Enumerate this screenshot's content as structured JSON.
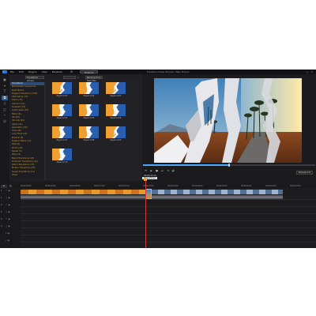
{
  "app": {
    "menu": [
      "File",
      "Edit",
      "Plugins",
      "View",
      "Playback"
    ],
    "gear_icon": "gear-icon",
    "produce_label": "Produce",
    "project_title": "Transition Video Tutorial - Main Project"
  },
  "toolbar": {
    "tools": [
      {
        "name": "media-icon",
        "glyph": "▣"
      },
      {
        "name": "effects-icon",
        "glyph": "✦"
      },
      {
        "name": "title-icon",
        "glyph": "T"
      },
      {
        "name": "transition-icon",
        "glyph": "⧉"
      },
      {
        "name": "audio-icon",
        "glyph": "♫"
      },
      {
        "name": "pip-icon",
        "glyph": "◫"
      },
      {
        "name": "particle-icon",
        "glyph": "✧"
      },
      {
        "name": "sticker-icon",
        "glyph": "☺"
      }
    ],
    "active_index": 3
  },
  "library": {
    "dropdown": "Transitions Library",
    "filter": "Remove from Favorites",
    "categories": [
      "Transitions",
      "Blockbuster Sequences",
      "Dual Motion",
      "Elegant Transitions (125)",
      "Alternative (72)",
      "Glitch (15)",
      "Cartoon (11)",
      "Gradient (53)",
      "Light Leaks (22)",
      "Block (6)",
      "3D (84)",
      "3D-Like (40)",
      "Alpha (41)",
      "Geometric (39)",
      "Grid (18)",
      "Lens Flare (20)",
      "Medical (8)",
      "Organic Blend (11)",
      "Peel (9)",
      "Photo (13)",
      "Speed (5)",
      "Wipe (4)",
      "Blend Transitions (23)",
      "Dramatic Transitions (32)",
      "Glitch Transitions (15)",
      "Motion Transitions (35)",
      "Shape Transitions (11)",
      "Other"
    ],
    "selected_category_index": 0,
    "thumbs": [
      {
        "label": "Papercut 01",
        "col": 0,
        "row": 0,
        "variant": "a"
      },
      {
        "label": "Papercut 02",
        "col": 1,
        "row": 0,
        "variant": "b"
      },
      {
        "label": "Papercut 03",
        "col": 2,
        "row": 0,
        "variant": "a"
      },
      {
        "label": "Papercut 04",
        "col": 0,
        "row": 1,
        "variant": "b"
      },
      {
        "label": "Papercut 05",
        "col": 1,
        "row": 1,
        "variant": "b"
      },
      {
        "label": "Papercut 06",
        "col": 2,
        "row": 1,
        "variant": "b"
      },
      {
        "label": "Papercut 07",
        "col": 0,
        "row": 2,
        "variant": "b"
      },
      {
        "label": "Papercut 08",
        "col": 1,
        "row": 2,
        "variant": "b"
      },
      {
        "label": "Papercut 09",
        "col": 2,
        "row": 2,
        "variant": "a"
      },
      {
        "label": "Papercut 10",
        "col": 0,
        "row": 3,
        "variant": "b"
      }
    ]
  },
  "preview": {
    "progress_fraction": 0.5,
    "controls": [
      "⏮",
      "▶",
      "■",
      "⏭",
      "⟲",
      "🔊"
    ],
    "timecode": "00:00:30:16",
    "resolution": "Preview 1/2",
    "tooltip": "Stop (Ctrl+/)"
  },
  "timeline": {
    "btn_a": "⊞",
    "btn_b": "▤",
    "ticks": [
      "00:00:00:00",
      "00:00:04:00",
      "00:00:08:00",
      "00:00:12:00",
      "00:00:16:00",
      "00:00:20:00",
      "00:00:24:00",
      "00:00:28:00",
      "00:00:32:00",
      "00:00:36:00",
      "00:00:40:00",
      "00:00:44:00"
    ],
    "tracks": [
      {
        "num": "1",
        "icon": "▭"
      },
      {
        "num": "1",
        "icon": "♫"
      },
      {
        "num": "2",
        "icon": "▭"
      },
      {
        "num": "2",
        "icon": "♫"
      },
      {
        "num": "3",
        "icon": "▭"
      },
      {
        "num": "3",
        "icon": "♫"
      },
      {
        "num": "",
        "icon": "T"
      },
      {
        "num": "",
        "icon": "♪"
      }
    ]
  },
  "colors": {
    "accent": "#4ea6ff",
    "orange": "#e69a2e",
    "playhead": "#d43a3a"
  }
}
